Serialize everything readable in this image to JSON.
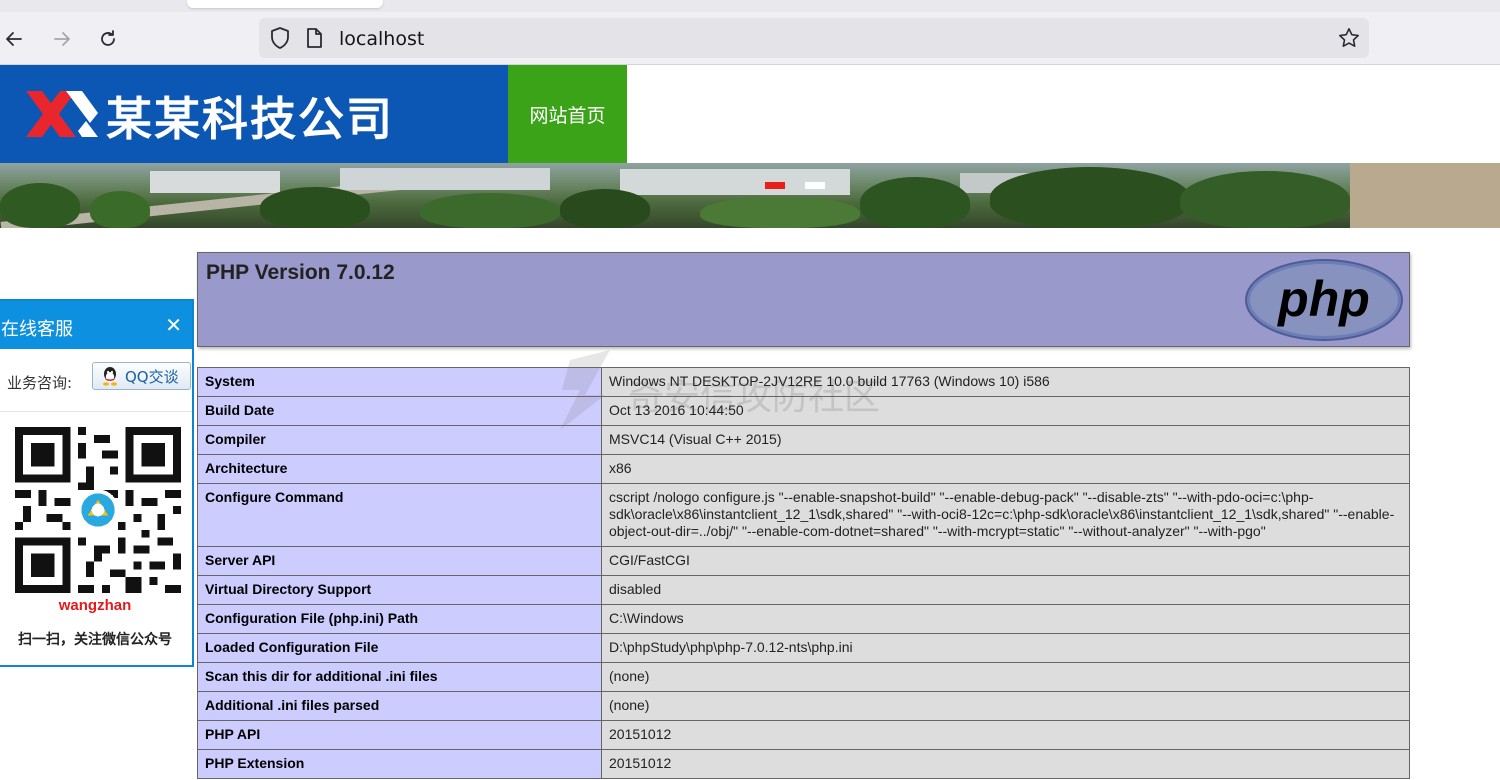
{
  "browser": {
    "url": "localhost",
    "icons": [
      "back-arrow-icon",
      "forward-arrow-icon",
      "reload-icon",
      "shield-icon",
      "page-icon",
      "star-icon"
    ]
  },
  "site": {
    "logo_text": "某某科技公司",
    "nav": [
      {
        "label": "网站首页"
      }
    ],
    "colors": {
      "logo_bg": "#0b57b3",
      "nav_bg": "#3aa318"
    }
  },
  "service_panel": {
    "title": "在线客服",
    "close": "✕",
    "consult_label": "业务咨询:",
    "qq_button": "QQ交谈",
    "name": "wangzhan",
    "follow_text": "扫一扫，关注微信公众号"
  },
  "phpinfo": {
    "title": "PHP Version 7.0.12",
    "logo_text": "php",
    "watermark": "奇安信攻防社区",
    "rows": [
      {
        "key": "System",
        "value": "Windows NT DESKTOP-2JV12RE 10.0 build 17763 (Windows 10) i586"
      },
      {
        "key": "Build Date",
        "value": "Oct 13 2016 10:44:50"
      },
      {
        "key": "Compiler",
        "value": "MSVC14 (Visual C++ 2015)"
      },
      {
        "key": "Architecture",
        "value": "x86"
      },
      {
        "key": "Configure Command",
        "value": "cscript /nologo configure.js \"--enable-snapshot-build\" \"--enable-debug-pack\" \"--disable-zts\" \"--with-pdo-oci=c:\\php-sdk\\oracle\\x86\\instantclient_12_1\\sdk,shared\" \"--with-oci8-12c=c:\\php-sdk\\oracle\\x86\\instantclient_12_1\\sdk,shared\" \"--enable-object-out-dir=../obj/\" \"--enable-com-dotnet=shared\" \"--with-mcrypt=static\" \"--without-analyzer\" \"--with-pgo\""
      },
      {
        "key": "Server API",
        "value": "CGI/FastCGI"
      },
      {
        "key": "Virtual Directory Support",
        "value": "disabled"
      },
      {
        "key": "Configuration File (php.ini) Path",
        "value": "C:\\Windows"
      },
      {
        "key": "Loaded Configuration File",
        "value": "D:\\phpStudy\\php\\php-7.0.12-nts\\php.ini"
      },
      {
        "key": "Scan this dir for additional .ini files",
        "value": "(none)"
      },
      {
        "key": "Additional .ini files parsed",
        "value": "(none)"
      },
      {
        "key": "PHP API",
        "value": "20151012"
      },
      {
        "key": "PHP Extension",
        "value": "20151012"
      }
    ]
  }
}
